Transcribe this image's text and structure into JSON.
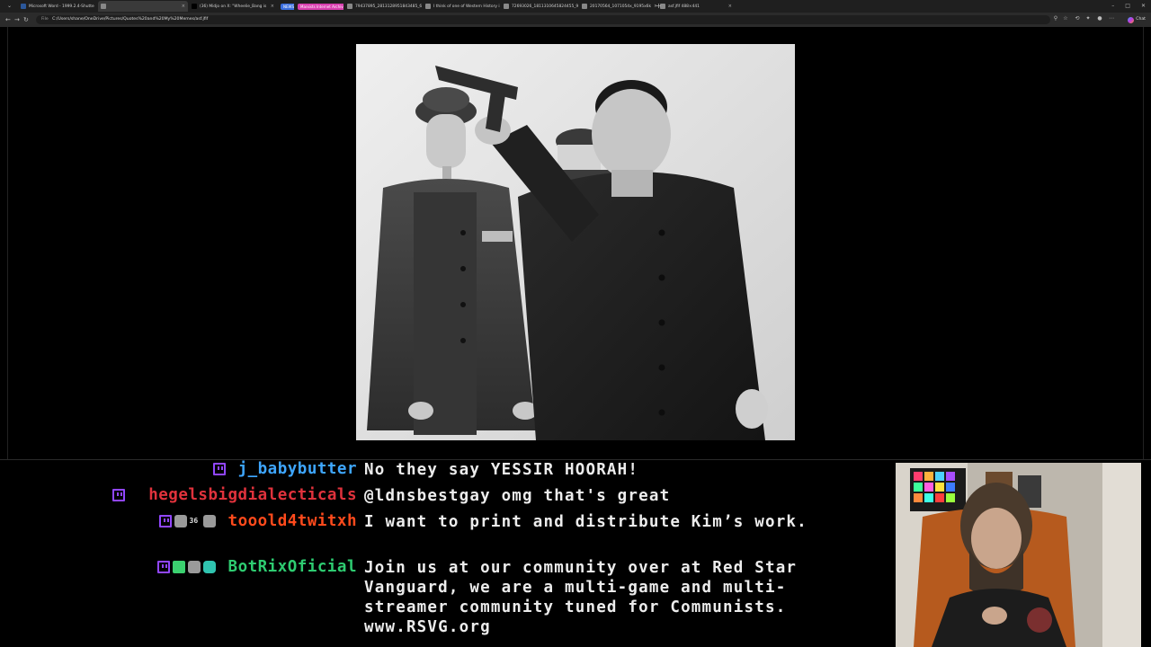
{
  "browser": {
    "tabs": [
      {
        "title": "Microsoft Word - 1999.2.4-Shutte",
        "active": false,
        "badge": "",
        "badge_color": "",
        "favicon_color": "#2b579a"
      },
      {
        "title": "",
        "active": true,
        "badge": "",
        "badge_color": "",
        "favicon_color": "#888888"
      },
      {
        "title": "(36) Midjo on X: \"Wheelie_Bang is",
        "active": false,
        "badge": "",
        "badge_color": "",
        "favicon_color": "#000000"
      },
      {
        "title": "",
        "active": false,
        "badge": "NEWS",
        "badge_color": "#3b6fe0",
        "favicon_color": "#3b6fe0"
      },
      {
        "title": "",
        "active": false,
        "badge": "Marxists Internet Archive",
        "badge_color": "#d93fb0",
        "favicon_color": "#d93fb0"
      },
      {
        "title": "79437895_2813128951843485_6",
        "active": false,
        "badge": "",
        "badge_color": "",
        "favicon_color": "#888888"
      },
      {
        "title": "I think of one of Western History i",
        "active": false,
        "badge": "",
        "badge_color": "",
        "favicon_color": "#888888"
      },
      {
        "title": "72693026_1811310645824455_9",
        "active": false,
        "badge": "",
        "badge_color": "",
        "favicon_color": "#888888"
      },
      {
        "title": "20170564_1071054x_9195x6k",
        "active": false,
        "badge": "",
        "badge_color": "",
        "favicon_color": "#888888"
      },
      {
        "title": "asf.jfif 488×441",
        "active": false,
        "badge": "",
        "badge_color": "",
        "favicon_color": "#888888"
      }
    ],
    "new_tab": "+",
    "window_controls": [
      "–",
      "□",
      "✕"
    ],
    "address": {
      "protocol": "File",
      "url": "C:/Users/shane/OneDrive/Pictures/Quotes%20and%20My%20Memes/asf.jfif"
    },
    "copilot_label": "Chat"
  },
  "chat": {
    "messages": [
      {
        "badges": [
          "twitch"
        ],
        "username": "j_babybutter",
        "color": "#3ea6ff",
        "text": "No they say YESSIR HOORAH!"
      },
      {
        "badges": [
          "twitch"
        ],
        "username": "hegelsbigdialecticals",
        "color": "#e0323c",
        "text": "@ldnsbestgay omg that's great"
      },
      {
        "badges": [
          "twitch",
          "gray",
          "small-36",
          "gray"
        ],
        "username": "tooold4twitxh",
        "color": "#ff4a1c",
        "text": "I want to print and distribute Kim’s work."
      },
      {
        "badges": [
          "twitch",
          "green",
          "gray",
          "teal"
        ],
        "username": "BotRixOficial",
        "color": "#2ecc71",
        "text": "Join us at our community over at Red Star Vanguard, we are a multi-game and multi-streamer community tuned for Communists. www.RSVG.org"
      }
    ]
  }
}
